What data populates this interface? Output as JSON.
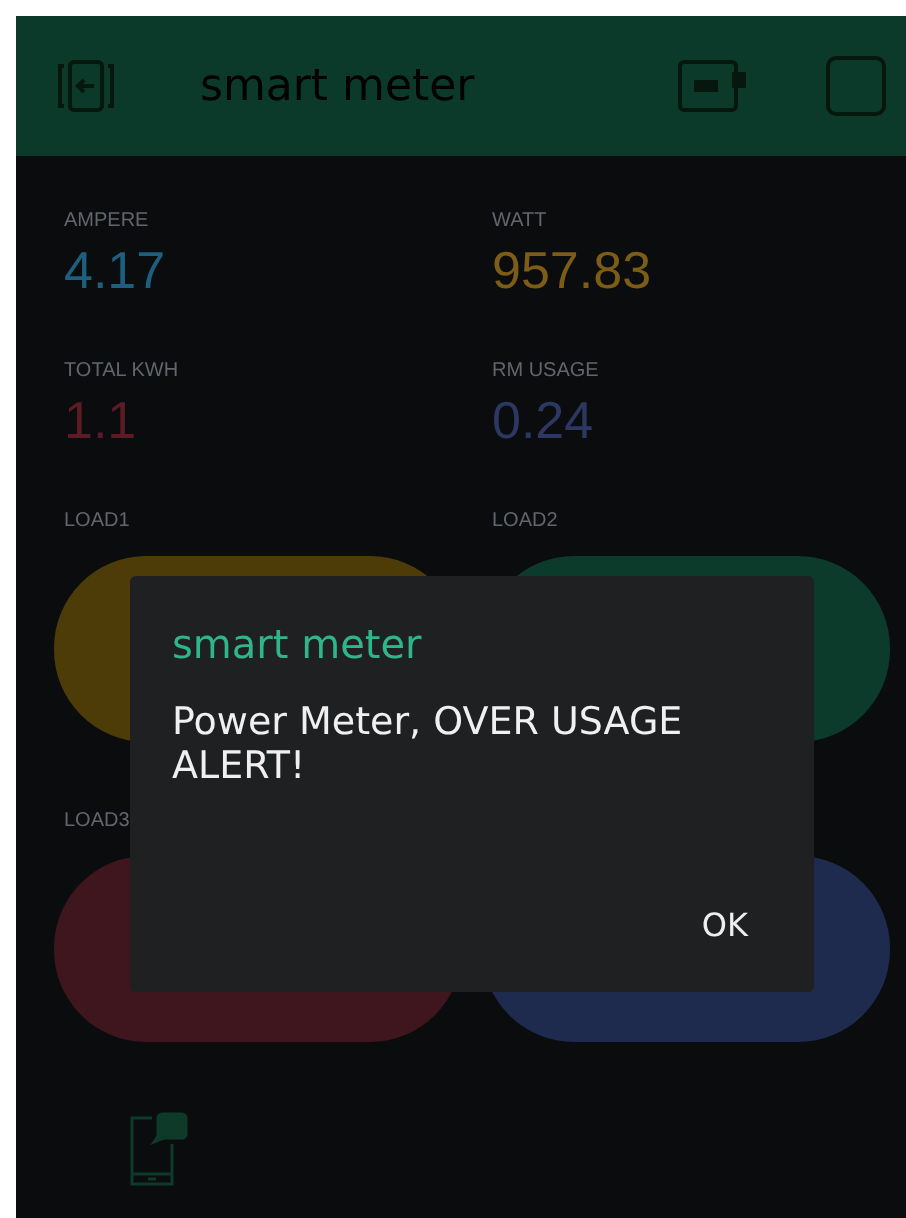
{
  "header": {
    "title": "smart meter"
  },
  "displays": [
    {
      "label": "AMPERE",
      "value": "4.17",
      "color": "#1d5f7c"
    },
    {
      "label": "WATT",
      "value": "957.83",
      "color": "#7c5c16"
    },
    {
      "label": "TOTAL KWH",
      "value": "1.1",
      "color": "#5c1b25"
    },
    {
      "label": "RM USAGE",
      "value": "0.24",
      "color": "#2c3862"
    }
  ],
  "loads": [
    {
      "label": "LOAD1",
      "color": "#4d3c08"
    },
    {
      "label": "LOAD2",
      "color": "#0c3b2b"
    },
    {
      "label": "LOAD3",
      "color": "#3f161d"
    },
    {
      "color": "#1e2a4e"
    }
  ],
  "dialog": {
    "title": "smart meter",
    "message": "Power Meter, OVER USAGE ALERT!",
    "button": "OK"
  }
}
